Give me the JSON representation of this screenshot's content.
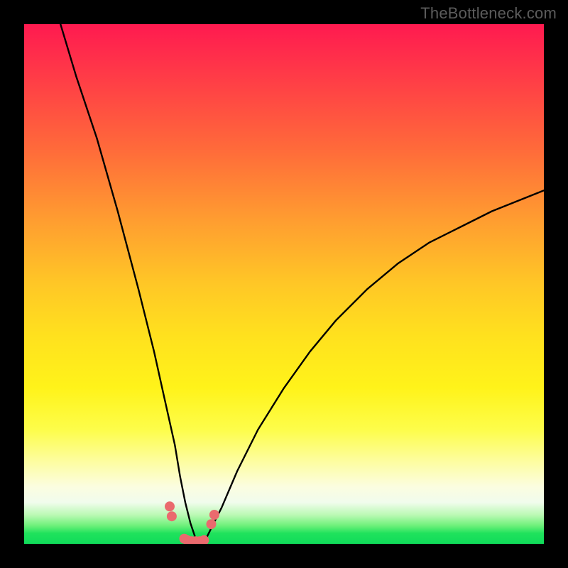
{
  "watermark": "TheBottleneck.com",
  "colors": {
    "frame": "#000000",
    "curve": "#000000",
    "trough_marker": "#ea6a6e",
    "gradient_top": "#ff1a50",
    "gradient_bottom": "#10db5a"
  },
  "chart_data": {
    "type": "line",
    "title": "",
    "xlabel": "",
    "ylabel": "",
    "xlim": [
      0,
      100
    ],
    "ylim": [
      0,
      100
    ],
    "grid": false,
    "legend": false,
    "annotations": [],
    "background": "vertical-gradient red→orange→yellow→green (top=high bottleneck, bottom=low)",
    "series": [
      {
        "name": "curve",
        "type": "line",
        "comment": "V-shaped curve; y≈100 at x≈7, drops to y≈0 near x≈33, rises to y≈68 at x=100",
        "x": [
          7,
          10,
          14,
          18,
          22,
          25,
          27,
          29,
          30,
          31,
          32,
          33,
          34,
          35,
          36,
          38,
          41,
          45,
          50,
          55,
          60,
          66,
          72,
          78,
          84,
          90,
          95,
          100
        ],
        "y": [
          100,
          90,
          78,
          64,
          49,
          37,
          28,
          19,
          13,
          8,
          4,
          1,
          0,
          1,
          3,
          7,
          14,
          22,
          30,
          37,
          43,
          49,
          54,
          58,
          61,
          64,
          66,
          68
        ]
      },
      {
        "name": "trough-markers",
        "type": "scatter",
        "comment": "pink-red dots flanking the trough near y≈0",
        "x": [
          28,
          28.4,
          30.8,
          31.4,
          32.2,
          33,
          33.8,
          34.6,
          36,
          36.6
        ],
        "y": [
          7.2,
          5.3,
          1.0,
          0.7,
          0.5,
          0.5,
          0.5,
          0.7,
          3.8,
          5.6
        ]
      }
    ]
  }
}
